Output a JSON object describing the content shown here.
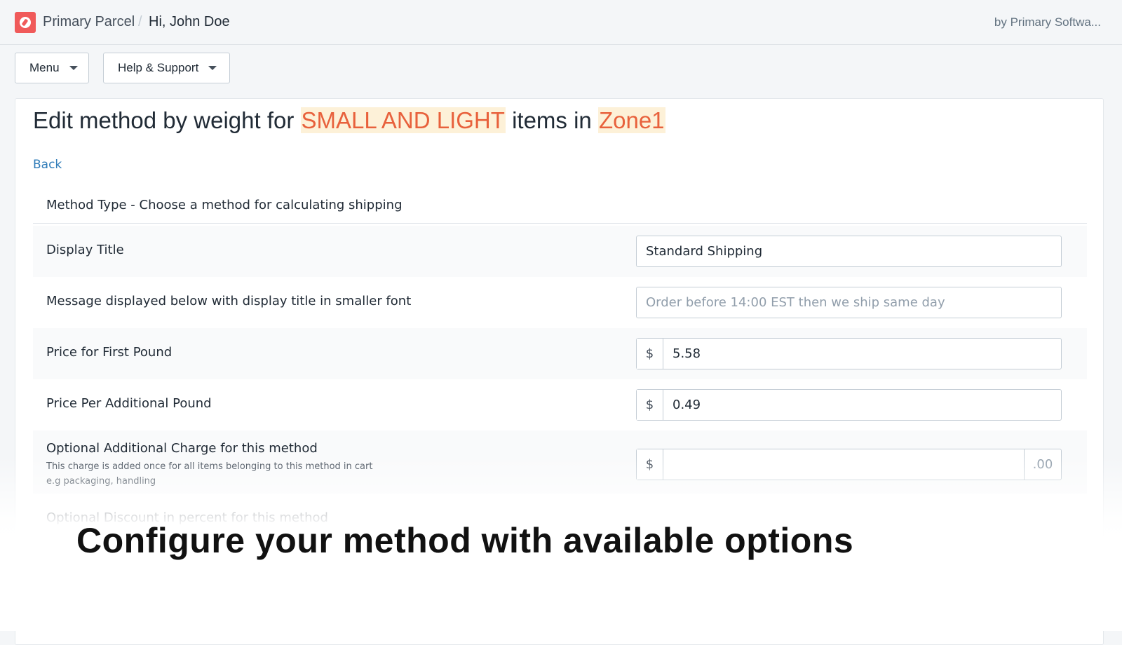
{
  "header": {
    "app_name": "Primary Parcel",
    "separator": "/",
    "greeting": "Hi, John Doe",
    "vendor": "by Primary Softwa..."
  },
  "nav": {
    "menu_label": "Menu",
    "help_label": "Help & Support"
  },
  "page": {
    "title_prefix": "Edit method by weight for ",
    "title_highlight_1": "SMALL AND LIGHT",
    "title_middle": " items in ",
    "title_highlight_2": "Zone1",
    "back_label": "Back",
    "section_heading": "Method Type - Choose a method for calculating shipping"
  },
  "form": {
    "display_title": {
      "label": "Display Title",
      "value": "Standard Shipping"
    },
    "message": {
      "label": "Message displayed below with display title in smaller font",
      "placeholder": "Order before 14:00 EST then we ship same day"
    },
    "first_pound": {
      "label": "Price for First Pound",
      "currency": "$",
      "value": "5.58"
    },
    "additional_pound": {
      "label": "Price Per Additional Pound",
      "currency": "$",
      "value": "0.49"
    },
    "additional_charge": {
      "label": "Optional Additional Charge for this method",
      "help_line_1": "This charge is added once for all items belonging to this method in cart",
      "help_line_2": "e.g packaging, handling",
      "currency": "$",
      "suffix": ".00"
    },
    "discount": {
      "label": "Optional Discount in percent for this method"
    }
  },
  "caption": {
    "text": "Configure your method with available options"
  },
  "colors": {
    "brand": "#f05a5a",
    "highlight_text": "#e8613c",
    "highlight_bg": "#fdf1d8",
    "link": "#2e7bb8"
  }
}
